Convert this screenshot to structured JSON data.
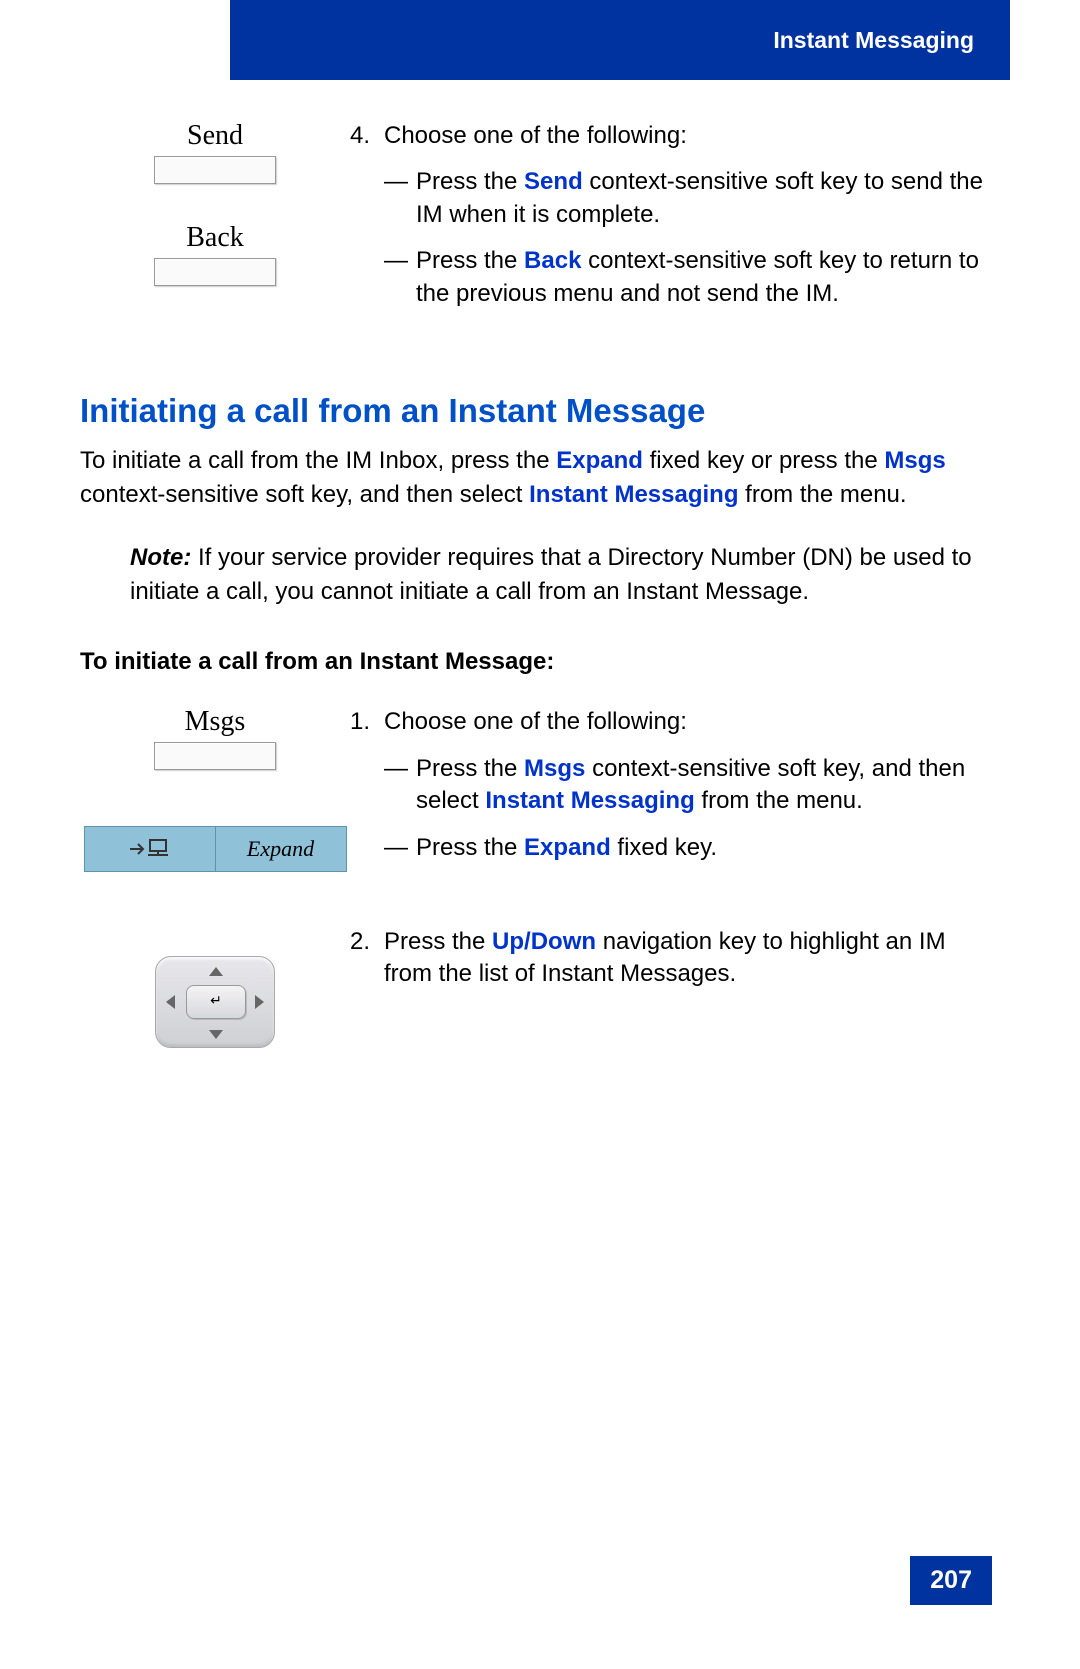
{
  "header_label": "Instant Messaging",
  "softkeys": {
    "send": "Send",
    "back": "Back",
    "msgs": "Msgs"
  },
  "expand_key_label": "Expand",
  "step4": {
    "number": "4.",
    "lead": "Choose one of the following:",
    "opt_a_pre": "Press the ",
    "opt_a_key": "Send",
    "opt_a_post": " context-sensitive soft key to send the IM when it is complete.",
    "opt_b_pre": "Press the ",
    "opt_b_key": "Back",
    "opt_b_post": " context-sensitive soft key to return to the previous menu and not send the IM."
  },
  "section_title": "Initiating a call from an Instant Message",
  "intro": {
    "pre1": "To initiate a call from the IM Inbox, press the ",
    "kw1": "Expand",
    "mid1": " fixed key or press the ",
    "kw2": "Msgs",
    "mid2": " context-sensitive soft key, and then select ",
    "kw3": "Instant Messaging",
    "post": " from the menu."
  },
  "note": {
    "label": "Note:",
    "body": "  If your service provider requires that a Directory Number (DN) be used to initiate a call, you cannot initiate a call from an Instant Message."
  },
  "subheading": "To initiate a call from an Instant Message:",
  "step1": {
    "number": "1.",
    "lead": "Choose one of the following:",
    "opt_a_pre": "Press the ",
    "opt_a_key1": "Msgs",
    "opt_a_mid": " context-sensitive soft key, and then select ",
    "opt_a_key2": "Instant Messaging",
    "opt_a_post": " from the menu.",
    "opt_b_pre": "Press the ",
    "opt_b_key": "Expand",
    "opt_b_post": " fixed key."
  },
  "step2": {
    "number": "2.",
    "pre": "Press the ",
    "key": "Up/Down",
    "post": " navigation key to highlight an IM from the list of Instant Messages."
  },
  "page_number": "207"
}
